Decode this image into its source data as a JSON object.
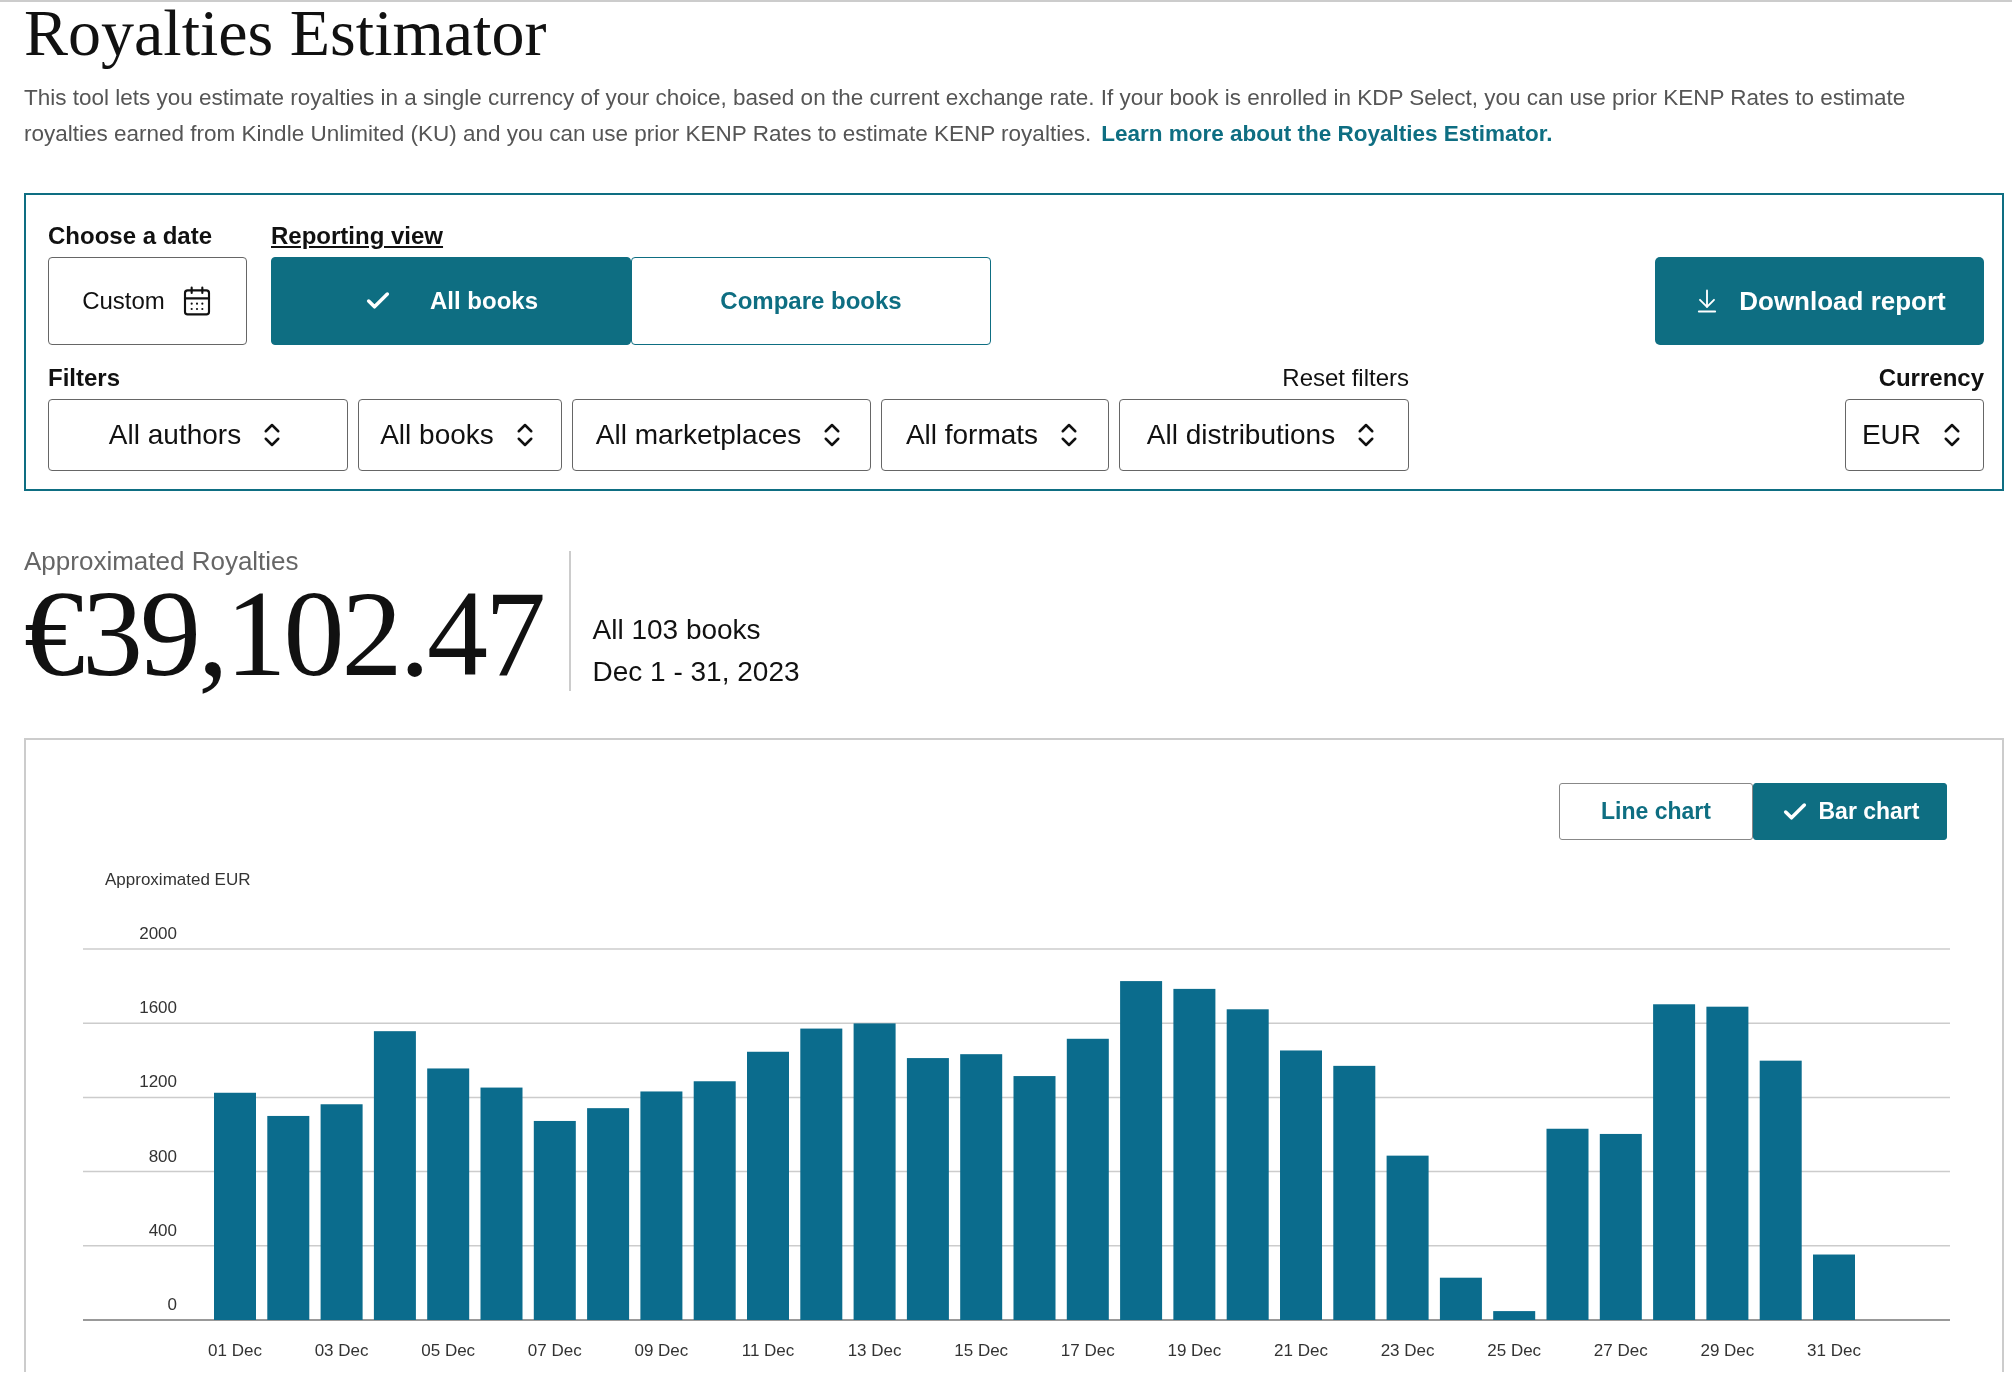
{
  "title": "Royalties Estimator",
  "description": "This tool lets you estimate royalties in a single currency of your choice, based on the current exchange rate. If your book is enrolled in KDP Select, you can use prior KENP Rates to estimate royalties earned from Kindle Unlimited (KU) and you can use prior KENP Rates to estimate KENP royalties.",
  "learn_more_link": "Learn more about the Royalties Estimator.",
  "controls": {
    "date": {
      "label": "Choose a date",
      "value": "Custom"
    },
    "reporting_view": {
      "label": "Reporting view",
      "options": [
        {
          "label": "All books",
          "selected": true
        },
        {
          "label": "Compare books",
          "selected": false
        }
      ]
    },
    "download_button": "Download report",
    "filters": {
      "label": "Filters",
      "reset": "Reset filters",
      "dropdowns": [
        "All authors",
        "All books",
        "All marketplaces",
        "All formats",
        "All distributions"
      ]
    },
    "currency": {
      "label": "Currency",
      "value": "EUR"
    }
  },
  "summary": {
    "label": "Approximated Royalties",
    "amount": "€39,102.47",
    "books": "All 103 books",
    "period": "Dec 1 - 31, 2023"
  },
  "chart": {
    "toggles": [
      {
        "label": "Line chart",
        "selected": false
      },
      {
        "label": "Bar chart",
        "selected": true
      }
    ],
    "chart_data": {
      "type": "bar",
      "ylabel": "Approximated EUR",
      "categories": [
        "01 Dec",
        null,
        "03 Dec",
        null,
        "05 Dec",
        null,
        "07 Dec",
        null,
        "09 Dec",
        null,
        "11 Dec",
        null,
        "13 Dec",
        null,
        "15 Dec",
        null,
        "17 Dec",
        null,
        "19 Dec",
        null,
        "21 Dec",
        null,
        "23 Dec",
        null,
        "25 Dec",
        null,
        "27 Dec",
        null,
        "29 Dec",
        null,
        "31 Dec"
      ],
      "values": [
        1225,
        1100,
        1163,
        1557,
        1356,
        1253,
        1073,
        1142,
        1232,
        1287,
        1446,
        1571,
        1599,
        1412,
        1433,
        1315,
        1516,
        1827,
        1785,
        1675,
        1453,
        1370,
        886,
        228,
        48,
        1031,
        1003,
        1702,
        1689,
        1398,
        353
      ],
      "ylim": [
        0,
        2000
      ],
      "yticks": [
        0,
        400,
        800,
        1200,
        1600,
        2000
      ],
      "grid": true
    }
  }
}
